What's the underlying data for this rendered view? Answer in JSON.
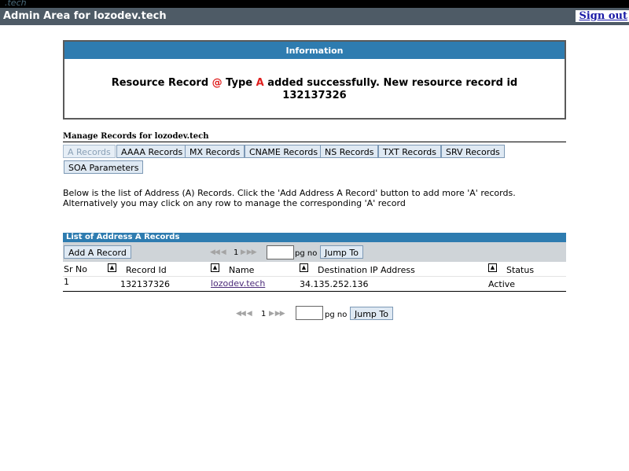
{
  "top_strip": {
    "text": ".tech"
  },
  "header": {
    "title": "Admin Area for lozodev.tech",
    "signout": "Sign out"
  },
  "info": {
    "heading": "Information",
    "msg_prefix": "Resource Record ",
    "msg_at": "@",
    "msg_type": " Type ",
    "msg_a": "A",
    "msg_suffix": " added successfully. New resource record id",
    "record_id": "132137326"
  },
  "manage": {
    "title": "Manage Records for lozodev.tech",
    "tabs": [
      {
        "label": "A Records"
      },
      {
        "label": "AAAA Records"
      },
      {
        "label": "MX Records"
      },
      {
        "label": "CNAME Records"
      },
      {
        "label": "NS Records"
      },
      {
        "label": "TXT Records"
      },
      {
        "label": "SRV Records"
      },
      {
        "label": "SOA Parameters"
      }
    ]
  },
  "description": "Below is the list of Address (A) Records. Click the 'Add Address A Record' button to add more 'A' records. Alternatively you may click on any row to manage the corresponding 'A' record",
  "list": {
    "heading": "List of Address A Records",
    "add_button": "Add A Record",
    "pager": {
      "page": "1",
      "pg_label": "pg no",
      "jump": "Jump To",
      "arrows": "◀◀ ◀",
      "arrows_next": "▶ ▶▶"
    },
    "columns": [
      "Sr No",
      "Record Id",
      "Name",
      "Destination IP Address",
      "Status"
    ],
    "sort_icon": "▲",
    "rows": [
      {
        "sr": "1",
        "record_id": "132137326",
        "name": "lozodev.tech",
        "ip": "34.135.252.136",
        "status": "Active"
      }
    ]
  }
}
